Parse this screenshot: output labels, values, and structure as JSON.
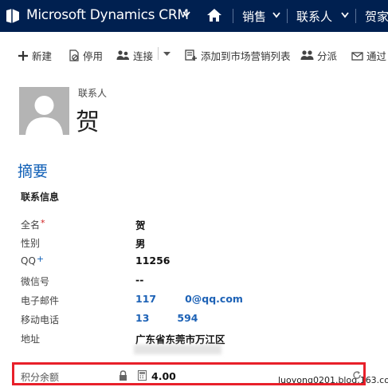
{
  "nav": {
    "app_title": "Microsoft Dynamics CRM",
    "items": [
      "销售",
      "联系人",
      "贺家"
    ]
  },
  "commands": {
    "new": "新建",
    "deactivate": "停用",
    "connect": "连接",
    "add_to_list": "添加到市场营销列表",
    "assign": "分派",
    "email_link": "通过"
  },
  "header": {
    "entity_type": "联系人",
    "record_name": "贺"
  },
  "section": {
    "title": "摘要",
    "group": "联系信息",
    "fields": [
      {
        "label": "全名",
        "marker": "*",
        "value": "贺"
      },
      {
        "label": "性别",
        "marker": "",
        "value": "男"
      },
      {
        "label": "QQ",
        "marker": "+",
        "value": "11256"
      },
      {
        "label": "微信号",
        "marker": "",
        "value": "--"
      },
      {
        "label": "电子邮件",
        "marker": "",
        "value": "117",
        "value_suffix": "0@qq.com"
      },
      {
        "label": "移动电话",
        "marker": "",
        "value": "13",
        "value_suffix": "594"
      },
      {
        "label": "地址",
        "marker": "",
        "value": "广东省东莞市万江区"
      }
    ],
    "credit": {
      "label": "积分余额",
      "value": "4.00"
    }
  },
  "watermark": "luoyong0201.blog.163.com",
  "colors": {
    "nav_bg": "#002050",
    "accent": "#1160b7",
    "highlight": "#e8202a"
  }
}
